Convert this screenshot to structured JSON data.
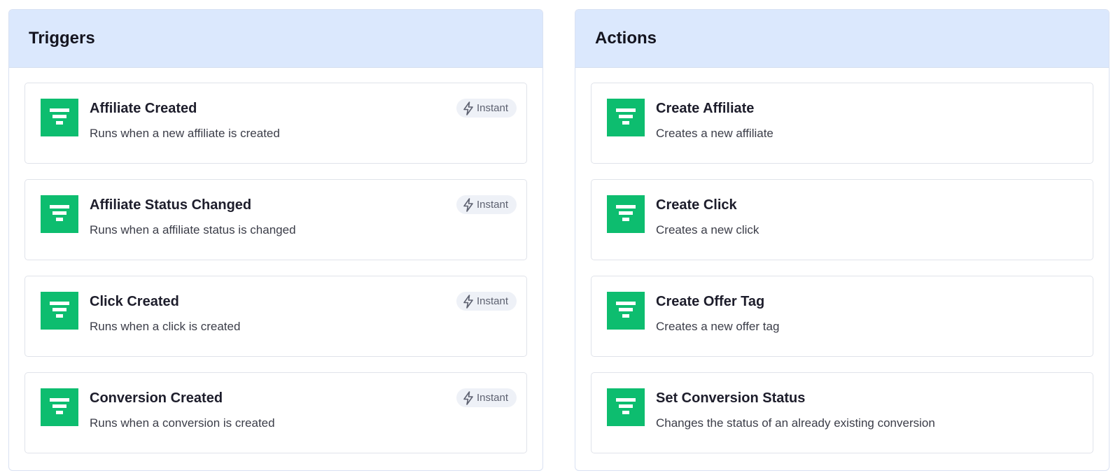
{
  "triggers": {
    "title": "Triggers",
    "items": [
      {
        "title": "Affiliate Created",
        "description": "Runs when a new affiliate is created",
        "badge": "Instant"
      },
      {
        "title": "Affiliate Status Changed",
        "description": "Runs when a affiliate status is changed",
        "badge": "Instant"
      },
      {
        "title": "Click Created",
        "description": "Runs when a click is created",
        "badge": "Instant"
      },
      {
        "title": "Conversion Created",
        "description": "Runs when a conversion is created",
        "badge": "Instant"
      }
    ]
  },
  "actions": {
    "title": "Actions",
    "items": [
      {
        "title": "Create Affiliate",
        "description": "Creates a new affiliate"
      },
      {
        "title": "Create Click",
        "description": "Creates a new click"
      },
      {
        "title": "Create Offer Tag",
        "description": "Creates a new offer tag"
      },
      {
        "title": "Set Conversion Status",
        "description": "Changes the status of an already existing conversion"
      }
    ]
  },
  "icons": {
    "app_icon": "funnel-icon",
    "badge_icon": "lightning-bolt-icon"
  },
  "colors": {
    "header_bg": "#dbe8fd",
    "app_icon_bg": "#0dbd6f",
    "badge_bg": "#eef1f7"
  }
}
